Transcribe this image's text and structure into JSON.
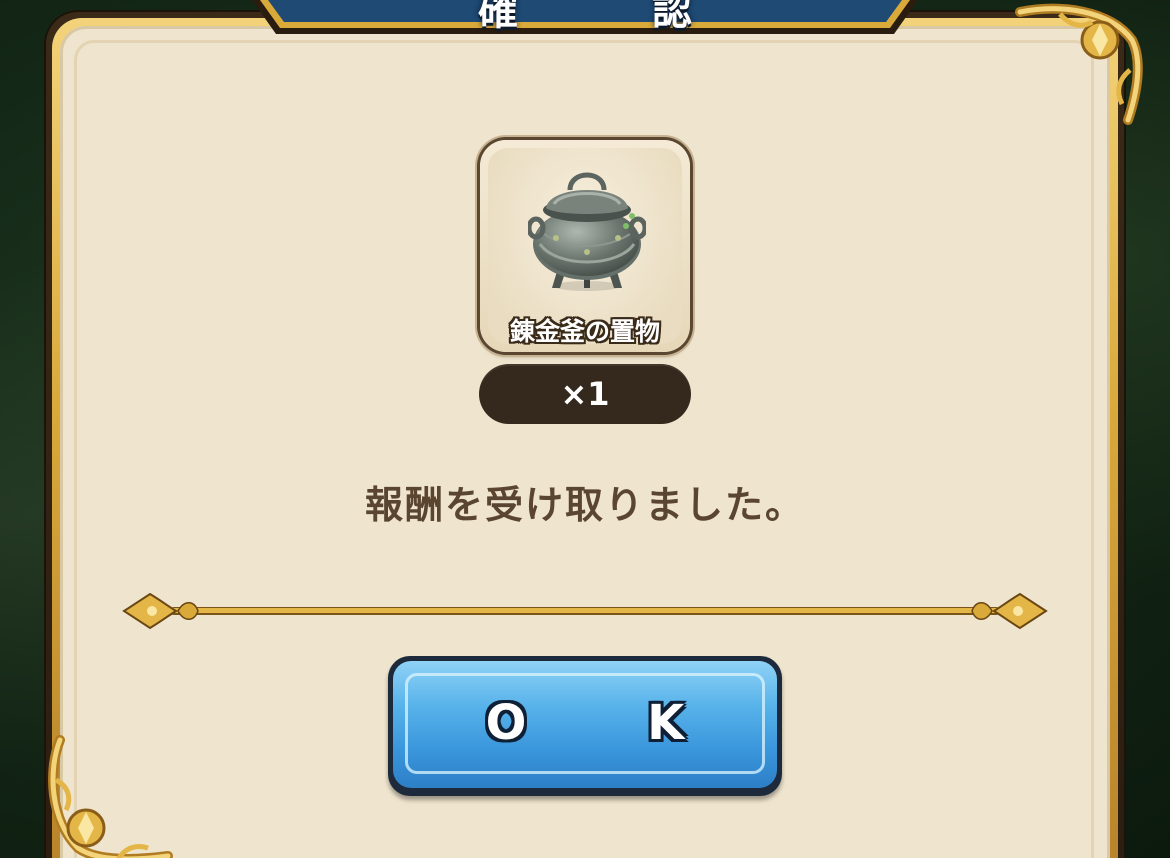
{
  "dialog": {
    "title": "確 認",
    "item": {
      "name": "錬金釜の置物",
      "icon": "cauldron-icon",
      "quantity": "×1"
    },
    "message": "報酬を受け取りました。",
    "ok_label": "O K"
  },
  "colors": {
    "panel": "#efe4cd",
    "gold_frame": "#d9a93a",
    "title_banner": "#1e4a74",
    "button_blue": "#3a96dc",
    "message_text": "#5a4530",
    "quantity_pill": "#35281c"
  }
}
